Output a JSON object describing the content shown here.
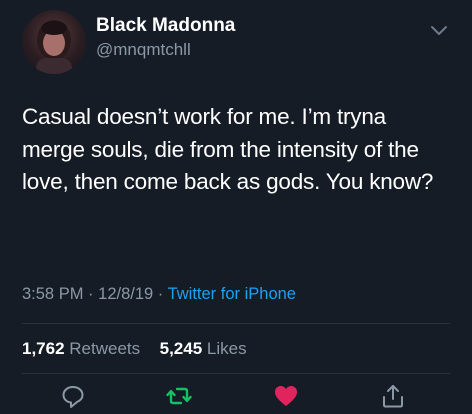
{
  "user": {
    "name": "Black Madonna",
    "handle": "@mnqmtchll"
  },
  "tweet": {
    "text": "Casual doesn’t work for me. I’m tryna merge souls, die from the intensity of the love, then come back as gods. You know?",
    "time": "3:58 PM",
    "date": "12/8/19",
    "source": "Twitter for iPhone"
  },
  "stats": {
    "retweets_count": "1,762",
    "retweets_label": "Retweets",
    "likes_count": "5,245",
    "likes_label": "Likes"
  },
  "colors": {
    "background": "#151c26",
    "secondary_text": "#8b98a5",
    "link": "#1da1f2",
    "retweet_icon": "#17bf63",
    "like_icon": "#e0245e"
  },
  "icons": {
    "caret": "chevron-down-icon",
    "reply": "reply-icon",
    "retweet": "retweet-icon",
    "like": "heart-icon",
    "share": "share-icon"
  }
}
